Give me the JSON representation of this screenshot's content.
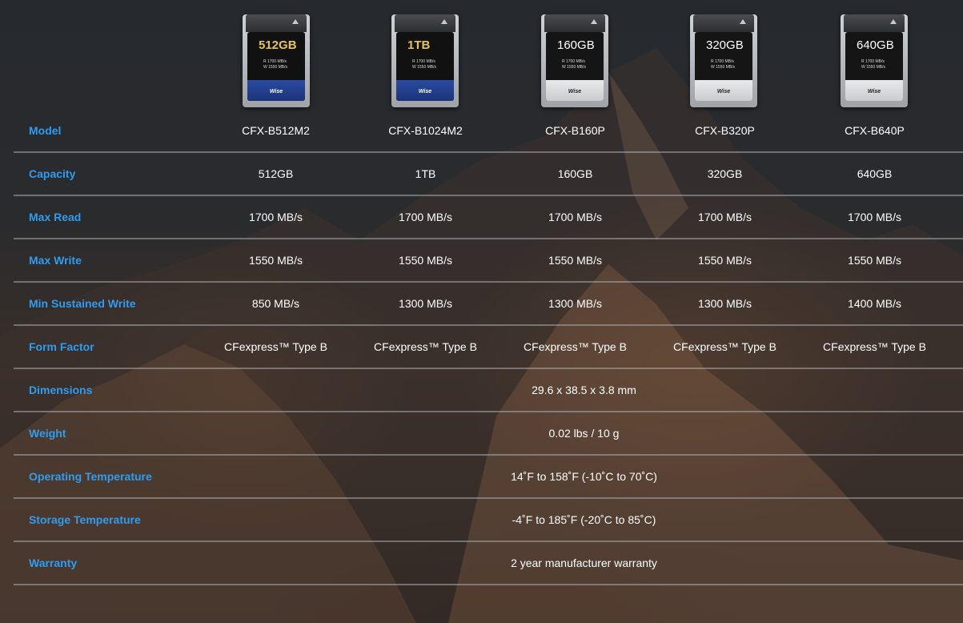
{
  "colors": {
    "label": "#2f9cf0",
    "value": "#ffffff",
    "divider": "#aaacb0"
  },
  "cards": [
    {
      "capacity": "512GB",
      "speed_read": "R 1700 MB/s",
      "speed_write": "W 1550 MB/s",
      "brand": "Wise",
      "style": "blue",
      "icon": "cfexpress-card-icon"
    },
    {
      "capacity": "1TB",
      "speed_read": "R 1700 MB/s",
      "speed_write": "W 1550 MB/s",
      "brand": "Wise",
      "style": "blue",
      "icon": "cfexpress-card-icon"
    },
    {
      "capacity": "160GB",
      "speed_read": "R 1700 MB/s",
      "speed_write": "W 1550 MB/s",
      "brand": "Wise",
      "style": "silver",
      "icon": "cfexpress-card-icon"
    },
    {
      "capacity": "320GB",
      "speed_read": "R 1700 MB/s",
      "speed_write": "W 1550 MB/s",
      "brand": "Wise",
      "style": "silver",
      "icon": "cfexpress-card-icon"
    },
    {
      "capacity": "640GB",
      "speed_read": "R 1700 MB/s",
      "speed_write": "W 1550 MB/s",
      "brand": "Wise",
      "style": "silver",
      "icon": "cfexpress-card-icon"
    }
  ],
  "rows": [
    {
      "label": "Model",
      "values": [
        "CFX-B512M2",
        "CFX-B1024M2",
        "CFX-B160P",
        "CFX-B320P",
        "CFX-B640P"
      ]
    },
    {
      "label": "Capacity",
      "values": [
        "512GB",
        "1TB",
        "160GB",
        "320GB",
        "640GB"
      ]
    },
    {
      "label": "Max Read",
      "values": [
        "1700 MB/s",
        "1700 MB/s",
        "1700 MB/s",
        "1700 MB/s",
        "1700 MB/s"
      ]
    },
    {
      "label": "Max Write",
      "values": [
        "1550 MB/s",
        "1550 MB/s",
        "1550 MB/s",
        "1550 MB/s",
        "1550 MB/s"
      ]
    },
    {
      "label": "Min Sustained Write",
      "values": [
        "850 MB/s",
        "1300 MB/s",
        "1300 MB/s",
        "1300 MB/s",
        "1400 MB/s"
      ]
    },
    {
      "label": "Form Factor",
      "values": [
        "CFexpress™ Type B",
        "CFexpress™ Type B",
        "CFexpress™ Type B",
        "CFexpress™ Type B",
        "CFexpress™ Type B"
      ]
    },
    {
      "label": "Dimensions",
      "span": "29.6 x 38.5 x 3.8 mm"
    },
    {
      "label": "Weight",
      "span": "0.02 lbs / 10 g"
    },
    {
      "label": "Operating Temperature",
      "span": "14˚F to 158˚F (-10˚C to 70˚C)"
    },
    {
      "label": "Storage Temperature",
      "span": "-4˚F to 185˚F (-20˚C to 85˚C)"
    },
    {
      "label": "Warranty",
      "span": "2 year manufacturer warranty"
    }
  ]
}
